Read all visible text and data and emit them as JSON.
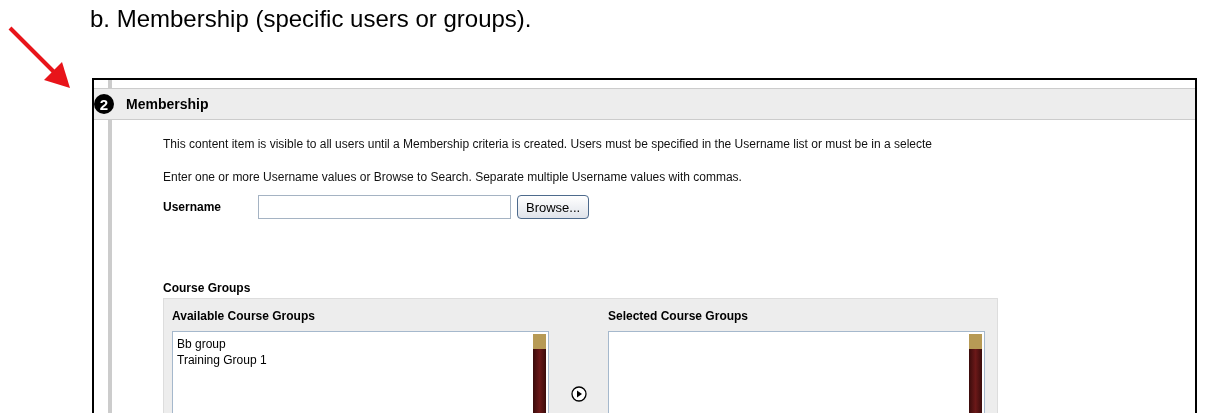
{
  "document": {
    "heading": "b. Membership (specific users or groups)."
  },
  "section": {
    "number": "2",
    "title": "Membership",
    "description": "This content item is visible to all users until a Membership criteria is created. Users must be specified in the Username list or must be in a selecte",
    "instruction": "Enter one or more Username values or Browse to Search. Separate multiple Username values with commas.",
    "username": {
      "label": "Username",
      "button": "Browse..."
    },
    "course_groups": {
      "label": "Course Groups",
      "available": {
        "label": "Available Course Groups",
        "items": [
          {
            "label": "Bb group",
            "selected": false
          },
          {
            "label": "Training Group 1",
            "selected": false
          }
        ]
      },
      "selected": {
        "label": "Selected Course Groups"
      }
    }
  }
}
